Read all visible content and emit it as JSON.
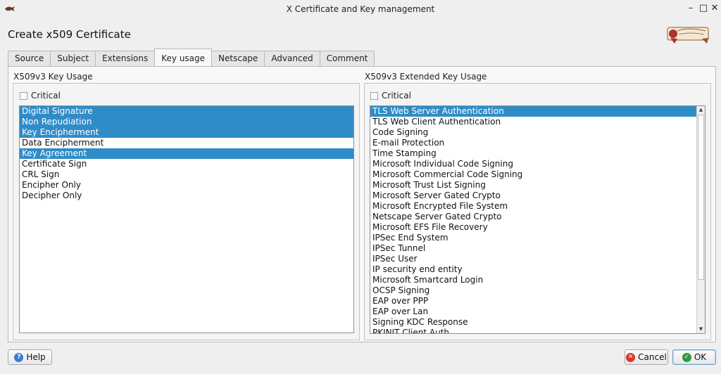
{
  "window": {
    "title": "X Certificate and Key management",
    "minimize_glyph": "–",
    "maximize_glyph": "□",
    "close_glyph": "✕"
  },
  "dialog": {
    "title": "Create x509 Certificate"
  },
  "tabs": [
    {
      "label": "Source",
      "active": false
    },
    {
      "label": "Subject",
      "active": false
    },
    {
      "label": "Extensions",
      "active": false
    },
    {
      "label": "Key usage",
      "active": true
    },
    {
      "label": "Netscape",
      "active": false
    },
    {
      "label": "Advanced",
      "active": false
    },
    {
      "label": "Comment",
      "active": false
    }
  ],
  "key_usage": {
    "label": "X509v3 Key Usage",
    "critical_label": "Critical",
    "critical_checked": false,
    "items": [
      {
        "label": "Digital Signature",
        "selected": true
      },
      {
        "label": "Non Repudiation",
        "selected": true
      },
      {
        "label": "Key Encipherment",
        "selected": true
      },
      {
        "label": "Data Encipherment",
        "selected": false
      },
      {
        "label": "Key Agreement",
        "selected": true
      },
      {
        "label": "Certificate Sign",
        "selected": false
      },
      {
        "label": "CRL Sign",
        "selected": false
      },
      {
        "label": "Encipher Only",
        "selected": false
      },
      {
        "label": "Decipher Only",
        "selected": false
      }
    ]
  },
  "extended_key_usage": {
    "label": "X509v3 Extended Key Usage",
    "critical_label": "Critical",
    "critical_checked": false,
    "items": [
      {
        "label": "TLS Web Server Authentication",
        "selected": true
      },
      {
        "label": "TLS Web Client Authentication",
        "selected": false
      },
      {
        "label": "Code Signing",
        "selected": false
      },
      {
        "label": "E-mail Protection",
        "selected": false
      },
      {
        "label": "Time Stamping",
        "selected": false
      },
      {
        "label": "Microsoft Individual Code Signing",
        "selected": false
      },
      {
        "label": "Microsoft Commercial Code Signing",
        "selected": false
      },
      {
        "label": "Microsoft Trust List Signing",
        "selected": false
      },
      {
        "label": "Microsoft Server Gated Crypto",
        "selected": false
      },
      {
        "label": "Microsoft Encrypted File System",
        "selected": false
      },
      {
        "label": "Netscape Server Gated Crypto",
        "selected": false
      },
      {
        "label": "Microsoft EFS File Recovery",
        "selected": false
      },
      {
        "label": "IPSec End System",
        "selected": false
      },
      {
        "label": "IPSec Tunnel",
        "selected": false
      },
      {
        "label": "IPSec User",
        "selected": false
      },
      {
        "label": "IP security end entity",
        "selected": false
      },
      {
        "label": "Microsoft Smartcard Login",
        "selected": false
      },
      {
        "label": "OCSP Signing",
        "selected": false
      },
      {
        "label": "EAP over PPP",
        "selected": false
      },
      {
        "label": "EAP over Lan",
        "selected": false
      },
      {
        "label": "Signing KDC Response",
        "selected": false
      },
      {
        "label": "PKINIT Client Auth",
        "selected": false
      }
    ],
    "scroll_up_glyph": "▲",
    "scroll_down_glyph": "▼"
  },
  "buttons": {
    "help_label": "Help",
    "cancel_label": "Cancel",
    "ok_label": "OK",
    "help_glyph": "?",
    "cancel_glyph": "✕",
    "ok_glyph": "✓"
  },
  "colors": {
    "selection": "#308cc6",
    "window_bg": "#efefef"
  }
}
